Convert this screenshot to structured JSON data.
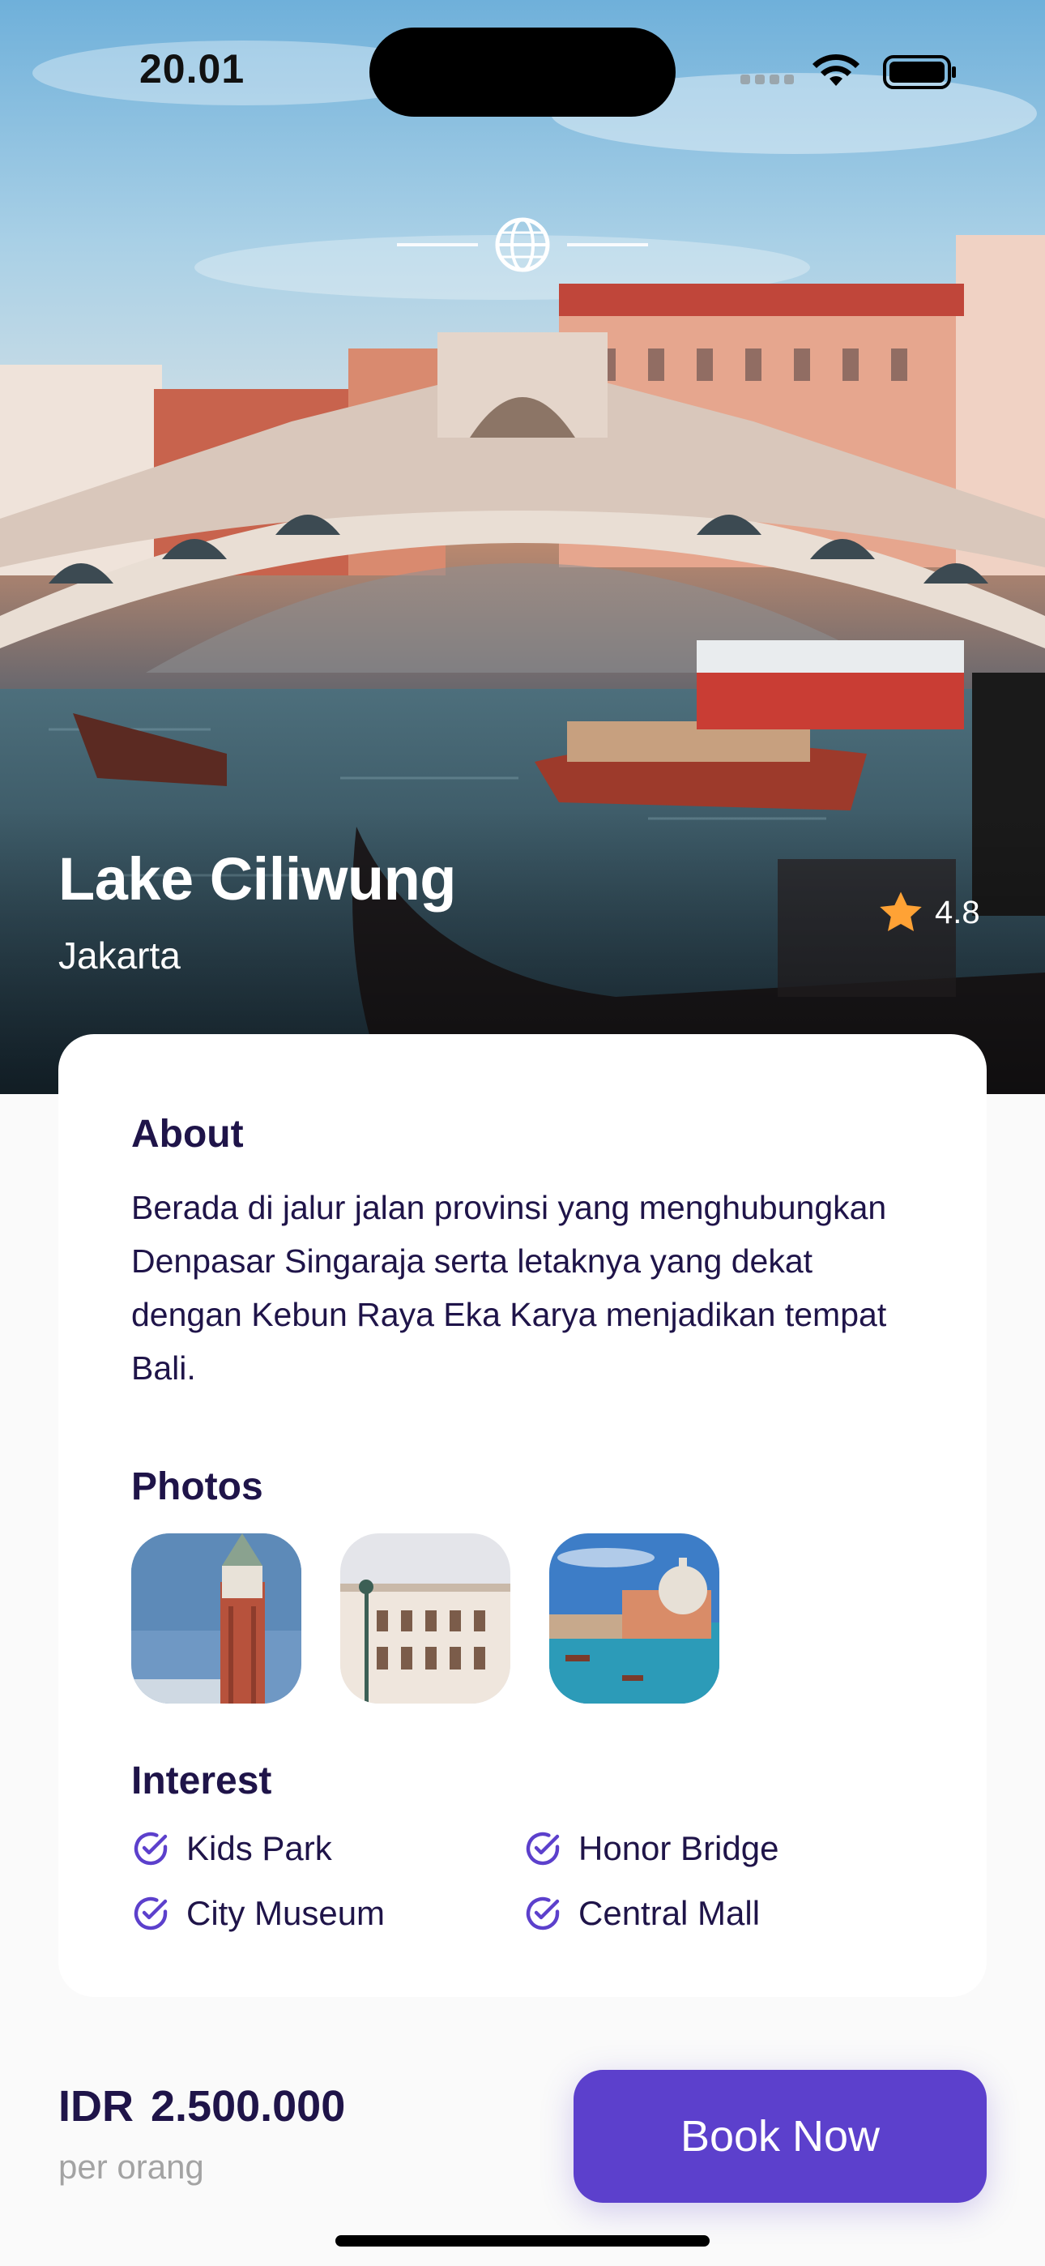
{
  "status_bar": {
    "time": "20.01"
  },
  "destination": {
    "name": "Lake Ciliwung",
    "city": "Jakarta",
    "rating": "4.8"
  },
  "about": {
    "title": "About",
    "text": "Berada di jalur jalan provinsi yang menghubungkan Denpasar Singaraja serta letaknya yang dekat dengan Kebun Raya Eka Karya menjadikan tempat Bali."
  },
  "photos": {
    "title": "Photos",
    "items": [
      "photo-bell-tower",
      "photo-building",
      "photo-canal-dome"
    ]
  },
  "interest": {
    "title": "Interest",
    "items": [
      "Kids Park",
      "Honor Bridge",
      "City Museum",
      "Central Mall"
    ]
  },
  "footer": {
    "price": "IDR 2.500.000",
    "per": "per orang",
    "book_label": "Book Now"
  },
  "colors": {
    "primary": "#5C40CC",
    "title_text": "#1F1449",
    "subtle_text": "#A3A3A3",
    "star": "#FFA235",
    "background": "#FAFAFA"
  }
}
